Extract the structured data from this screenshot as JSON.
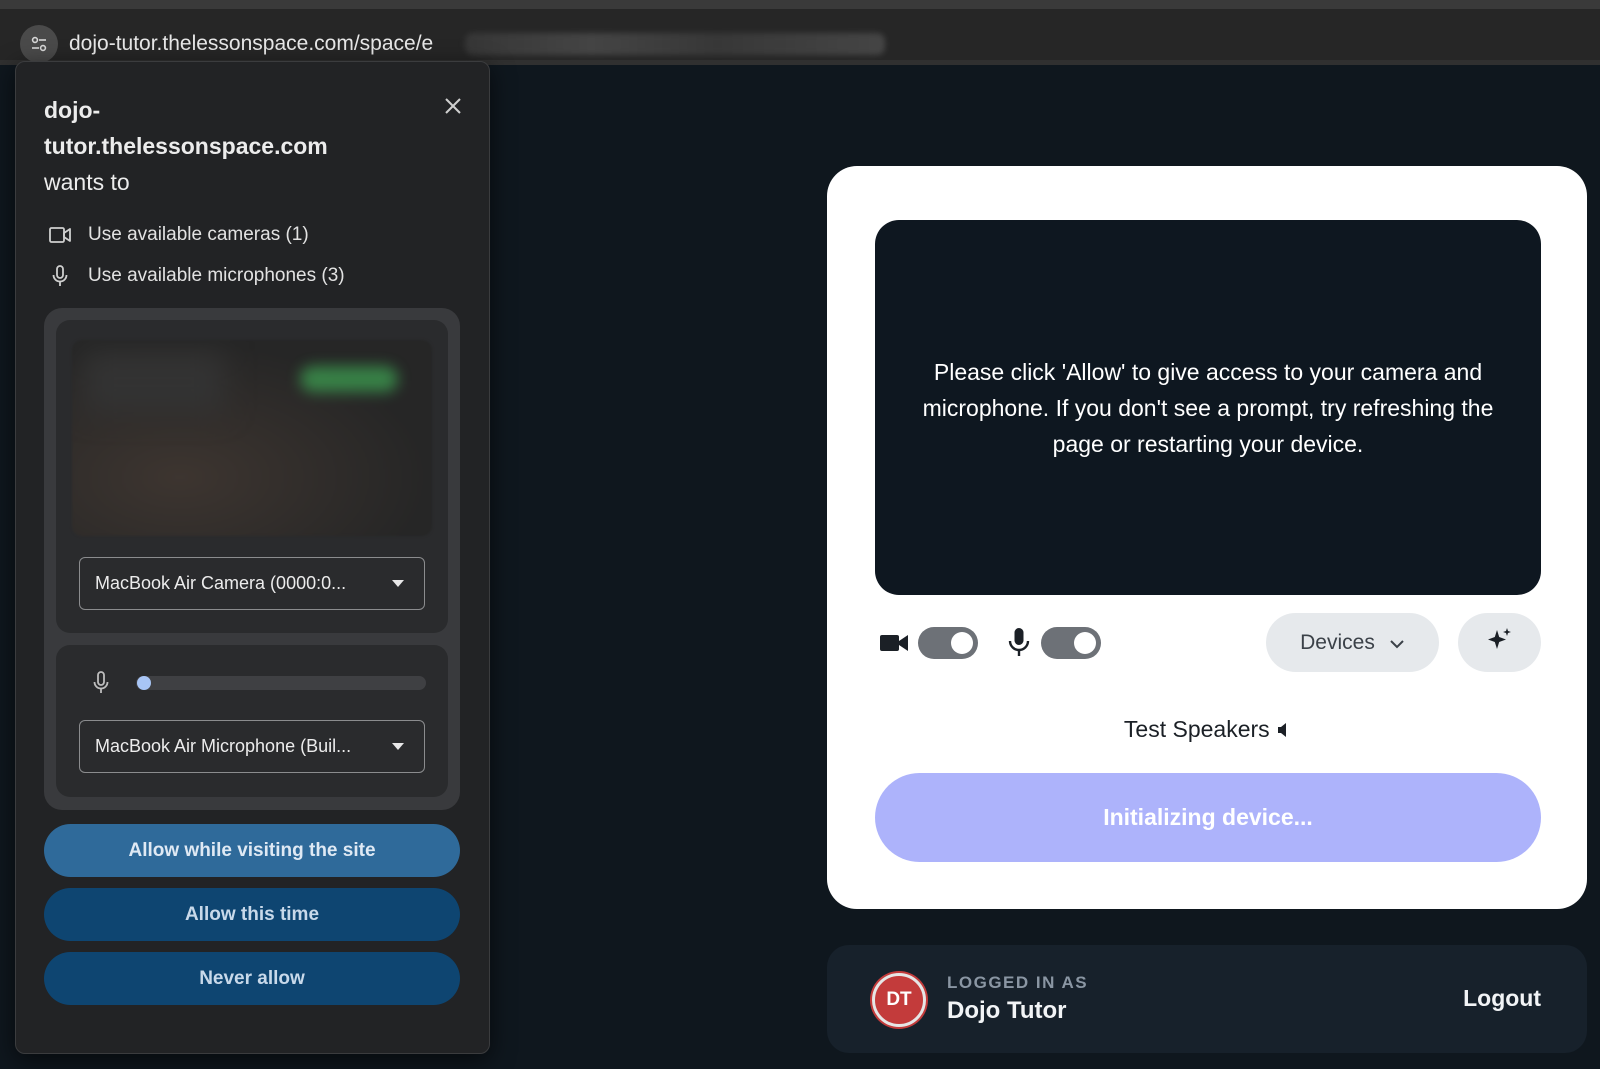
{
  "browser": {
    "url": "dojo-tutor.thelessonspace.com/space/e"
  },
  "permission_popup": {
    "title_line1": "dojo-",
    "title_line2": "tutor.thelessonspace.com",
    "title_line3": "wants to",
    "camera_permission": "Use available cameras (1)",
    "microphone_permission": "Use available microphones (3)",
    "camera_select": "MacBook Air Camera (0000:0...",
    "microphone_select": "MacBook Air Microphone (Buil...",
    "mic_level": 0.02,
    "buttons": {
      "allow_visiting": "Allow while visiting the site",
      "allow_once": "Allow this time",
      "never_allow": "Never allow"
    }
  },
  "device_setup": {
    "message": "Please click 'Allow' to give access to your camera and microphone. If you don't see a prompt, try refreshing the page or restarting your device.",
    "devices_label": "Devices",
    "test_speakers": "Test Speakers",
    "init_button": "Initializing device...",
    "camera_toggle_on": true,
    "mic_toggle_on": true
  },
  "account": {
    "logged_in_label": "LOGGED IN AS",
    "initials": "DT",
    "name": "Dojo Tutor",
    "logout": "Logout"
  },
  "colors": {
    "page_bg": "#0f171e",
    "popup_bg": "#222325",
    "primary_button": "#2f6a9a",
    "secondary_button": "#0e4571",
    "init_button": "#adb3fb",
    "avatar": "#c33b3b"
  }
}
